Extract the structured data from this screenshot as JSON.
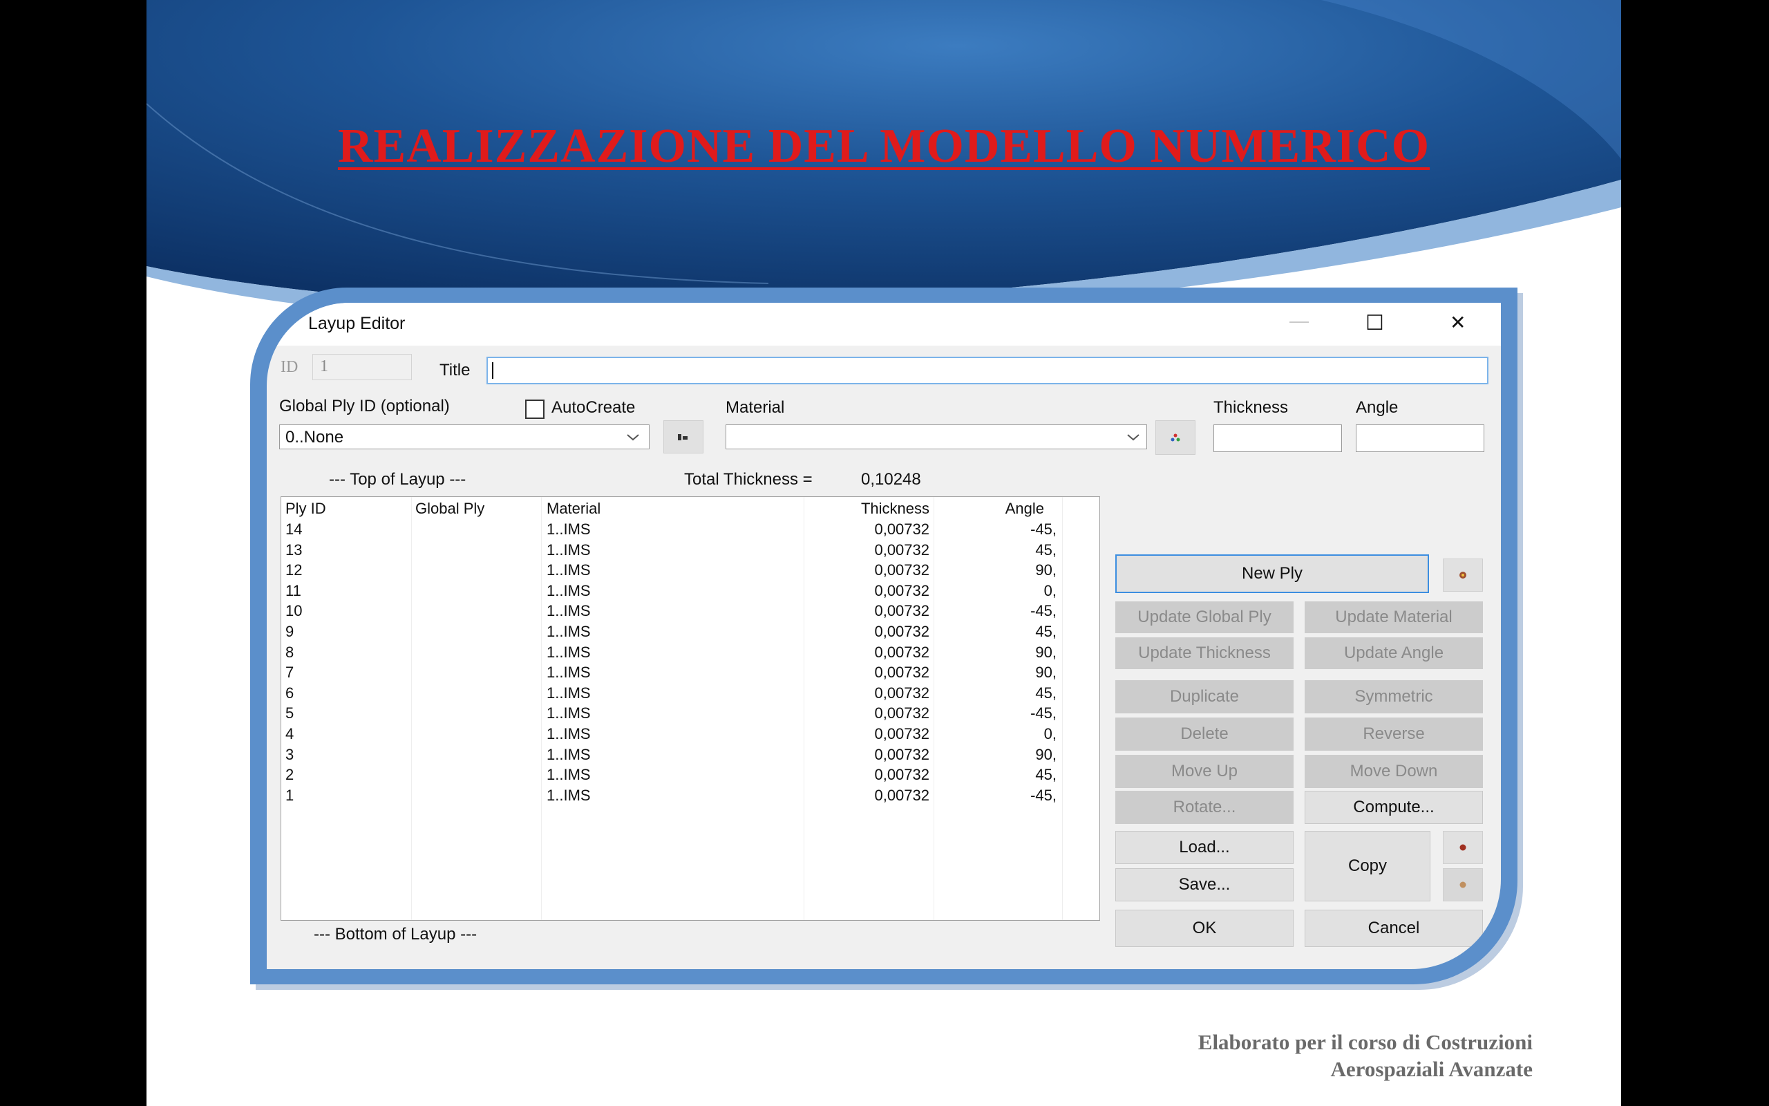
{
  "slide": {
    "title": "REALIZZAZIONE DEL MODELLO NUMERICO",
    "footer_line1": "Elaborato per il corso di Costruzioni",
    "footer_line2": "Aerospaziali Avanzate"
  },
  "dialog": {
    "title": "Layup Editor",
    "controls": {
      "minimize": "—",
      "maximize": "☐",
      "close": "✕"
    },
    "id_label": "ID",
    "id_value": "1",
    "title_label": "Title",
    "title_value": "",
    "global_ply_label": "Global Ply ID (optional)",
    "global_ply_value": "0..None",
    "autocreate_label": "AutoCreate",
    "autocreate_checked": false,
    "material_label": "Material",
    "material_value": "",
    "thickness_label": "Thickness",
    "thickness_value": "",
    "angle_label": "Angle",
    "angle_value": "",
    "top_label": "---  Top of Layup  ---",
    "total_thickness_label": "Total Thickness  =",
    "total_thickness_value": "0,10248",
    "bottom_label": "---  Bottom of Layup  ---",
    "columns": [
      "Ply ID",
      "Global Ply",
      "Material",
      "Thickness",
      "Angle"
    ],
    "rows": [
      {
        "ply_id": "14",
        "global_ply": "",
        "material": "1..IMS",
        "thickness": "0,00732",
        "angle": "-45,"
      },
      {
        "ply_id": "13",
        "global_ply": "",
        "material": "1..IMS",
        "thickness": "0,00732",
        "angle": "45,"
      },
      {
        "ply_id": "12",
        "global_ply": "",
        "material": "1..IMS",
        "thickness": "0,00732",
        "angle": "90,"
      },
      {
        "ply_id": "11",
        "global_ply": "",
        "material": "1..IMS",
        "thickness": "0,00732",
        "angle": "0,"
      },
      {
        "ply_id": "10",
        "global_ply": "",
        "material": "1..IMS",
        "thickness": "0,00732",
        "angle": "-45,"
      },
      {
        "ply_id": "9",
        "global_ply": "",
        "material": "1..IMS",
        "thickness": "0,00732",
        "angle": "45,"
      },
      {
        "ply_id": "8",
        "global_ply": "",
        "material": "1..IMS",
        "thickness": "0,00732",
        "angle": "90,"
      },
      {
        "ply_id": "7",
        "global_ply": "",
        "material": "1..IMS",
        "thickness": "0,00732",
        "angle": "90,"
      },
      {
        "ply_id": "6",
        "global_ply": "",
        "material": "1..IMS",
        "thickness": "0,00732",
        "angle": "45,"
      },
      {
        "ply_id": "5",
        "global_ply": "",
        "material": "1..IMS",
        "thickness": "0,00732",
        "angle": "-45,"
      },
      {
        "ply_id": "4",
        "global_ply": "",
        "material": "1..IMS",
        "thickness": "0,00732",
        "angle": "0,"
      },
      {
        "ply_id": "3",
        "global_ply": "",
        "material": "1..IMS",
        "thickness": "0,00732",
        "angle": "90,"
      },
      {
        "ply_id": "2",
        "global_ply": "",
        "material": "1..IMS",
        "thickness": "0,00732",
        "angle": "45,"
      },
      {
        "ply_id": "1",
        "global_ply": "",
        "material": "1..IMS",
        "thickness": "0,00732",
        "angle": "-45,"
      }
    ],
    "buttons": {
      "new_ply": "New Ply",
      "update_global_ply": "Update Global Ply",
      "update_material": "Update Material",
      "update_thickness": "Update Thickness",
      "update_angle": "Update Angle",
      "duplicate": "Duplicate",
      "symmetric": "Symmetric",
      "delete": "Delete",
      "reverse": "Reverse",
      "move_up": "Move Up",
      "move_down": "Move Down",
      "rotate": "Rotate...",
      "compute": "Compute...",
      "load": "Load...",
      "save": "Save...",
      "copy": "Copy",
      "ok": "OK",
      "cancel": "Cancel"
    },
    "icons": {
      "global_ply_pick": "pick-icon",
      "material_pick": "material-pick-icon",
      "new_ply_options": "options-icon",
      "copy_options": "copy-icon",
      "paste_options": "paste-icon"
    }
  },
  "colors": {
    "title_red": "#e01b1b",
    "header_blue": "#1f4f8f",
    "frame_blue": "#5b8fcb",
    "focus_blue": "#3c8ee0"
  }
}
